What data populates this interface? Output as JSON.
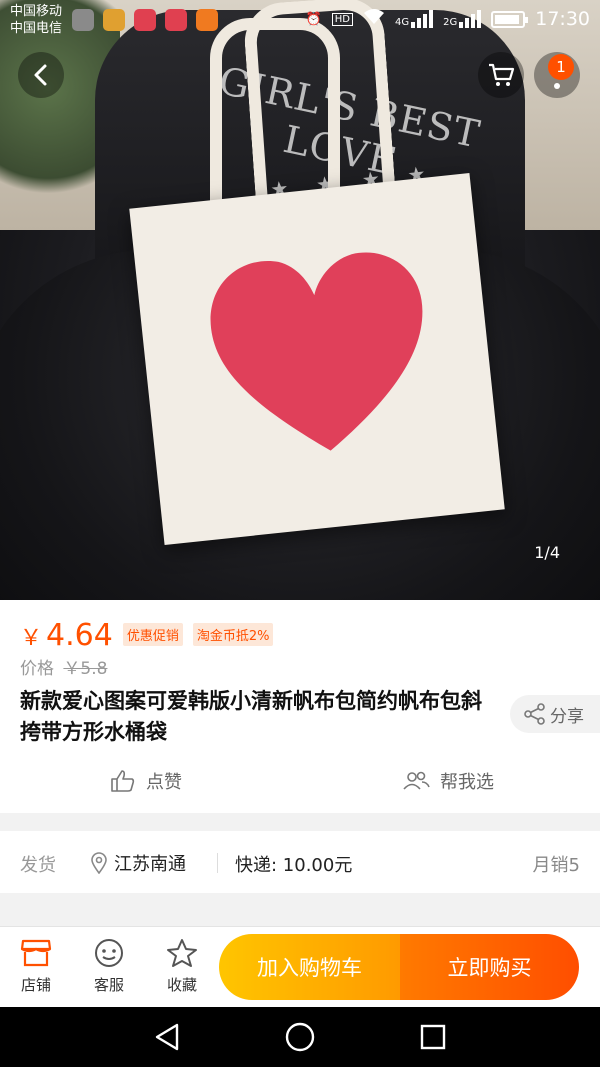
{
  "status_bar": {
    "carrier_1": "中国移动",
    "carrier_2": "中国电信",
    "hd_label": "HD",
    "net_1": "4G",
    "net_2": "2G",
    "time": "17:30"
  },
  "hero": {
    "image_counter": "1/4",
    "print_text": "GIRL'S BEST LOVE",
    "cart_badge": "1"
  },
  "product": {
    "currency": "￥",
    "price": "4.64",
    "tag_promo": "优惠促销",
    "tag_coin": "淘金币抵2%",
    "orig_label": "价格",
    "orig_price": "￥5.8",
    "title": "新款爱心图案可爱韩版小清新帆布包简约帆布包斜挎带方形水桶袋",
    "share_label": "分享",
    "like_label": "点赞",
    "help_label": "帮我选"
  },
  "shipping": {
    "label": "发货",
    "location": "江苏南通",
    "fee": "快递: 10.00元",
    "sales": "月销5"
  },
  "bottom_bar": {
    "shop_label": "店铺",
    "service_label": "客服",
    "fav_label": "收藏",
    "add_cart_label": "加入购物车",
    "buy_now_label": "立即购买"
  },
  "colors": {
    "accent": "#ff5000",
    "cart_gradient_start": "#ffc500",
    "buy_gradient_end": "#ff4e00"
  },
  "icons": [
    "back-arrow-icon",
    "cart-icon",
    "more-icon",
    "share-icon",
    "thumbs-up-icon",
    "group-icon",
    "location-pin-icon",
    "shop-icon",
    "service-icon",
    "star-icon",
    "nav-back-icon",
    "nav-home-icon",
    "nav-recent-icon"
  ]
}
